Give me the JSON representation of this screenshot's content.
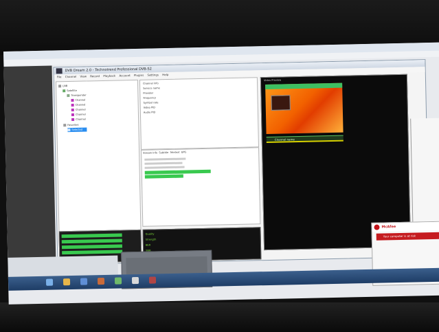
{
  "app": {
    "title": "DVB Dream 2.0 - Technotrend Professional DVB-S2",
    "menu": [
      "File",
      "Channel",
      "View",
      "Record",
      "Playback",
      "Account",
      "Plugins",
      "Settings",
      "Help"
    ]
  },
  "tree": {
    "items": [
      "LNB",
      "Satellite",
      "Transponder",
      "Channel",
      "Channel",
      "Channel",
      "Channel",
      "Channel",
      "Favorites",
      "Selected"
    ]
  },
  "info": {
    "lines": [
      "Channel info",
      "Service name",
      "Provider",
      "Frequency",
      "Symbol rate",
      "Video PID",
      "Audio PID"
    ]
  },
  "streams": {
    "tabs": [
      "Stream Info",
      "Subtitle",
      "Teletext",
      "EPG"
    ]
  },
  "preview": {
    "label": "Video Preview",
    "channel_bar": "Channel name"
  },
  "stats": {
    "labels": [
      "Quality",
      "Strength",
      "BER",
      "SNR"
    ]
  },
  "mcafee": {
    "brand": "McAfee",
    "banner": "Your computer is at risk"
  },
  "colors": {
    "accent_green": "#39c94f",
    "video_orange": "#f26100",
    "mcafee_red": "#c51b1f",
    "taskbar_blue": "#2a4c7a"
  }
}
